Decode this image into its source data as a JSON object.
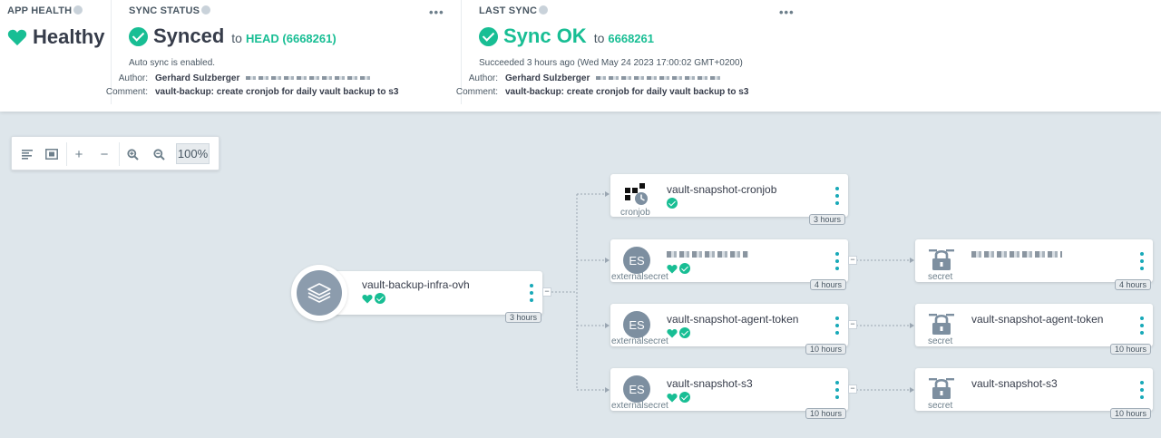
{
  "app_health": {
    "title": "APP HEALTH",
    "status": "Healthy"
  },
  "sync_status": {
    "title": "SYNC STATUS",
    "status": "Synced",
    "to_word": "to",
    "revision": "HEAD (6668261)",
    "auto_sync": "Auto sync is enabled.",
    "author_label": "Author:",
    "author_value": "Gerhard Sulzberger",
    "comment_label": "Comment:",
    "comment_value": "vault-backup: create cronjob for daily vault backup to s3"
  },
  "last_sync": {
    "title": "LAST SYNC",
    "status": "Sync OK",
    "to_word": "to",
    "revision": "6668261",
    "succeeded": "Succeeded 3 hours ago (Wed May 24 2023 17:00:02 GMT+0200)",
    "author_label": "Author:",
    "author_value": "Gerhard Sulzberger",
    "comment_label": "Comment:",
    "comment_value": "vault-backup: create cronjob for daily vault backup to s3"
  },
  "toolbar": {
    "zoom": "100%"
  },
  "colors": {
    "accent": "#18be94",
    "health_heart": "#18be94",
    "canvas": "#dee6eb",
    "menu_dots": "#18a9b8"
  },
  "graph": {
    "app": {
      "name": "vault-backup-infra-ovh",
      "age": "3 hours"
    },
    "cronjob": {
      "name": "vault-snapshot-cronjob",
      "kind": "cronjob",
      "age": "3 hours"
    },
    "es1": {
      "kind": "externalsecret",
      "icon": "ES",
      "age": "4 hours"
    },
    "es2": {
      "name": "vault-snapshot-agent-token",
      "kind": "externalsecret",
      "icon": "ES",
      "age": "10 hours"
    },
    "es3": {
      "name": "vault-snapshot-s3",
      "kind": "externalsecret",
      "icon": "ES",
      "age": "10 hours"
    },
    "sec1": {
      "kind": "secret",
      "age": "4 hours"
    },
    "sec2": {
      "name": "vault-snapshot-agent-token",
      "kind": "secret",
      "age": "10 hours"
    },
    "sec3": {
      "name": "vault-snapshot-s3",
      "kind": "secret",
      "age": "10 hours"
    }
  }
}
